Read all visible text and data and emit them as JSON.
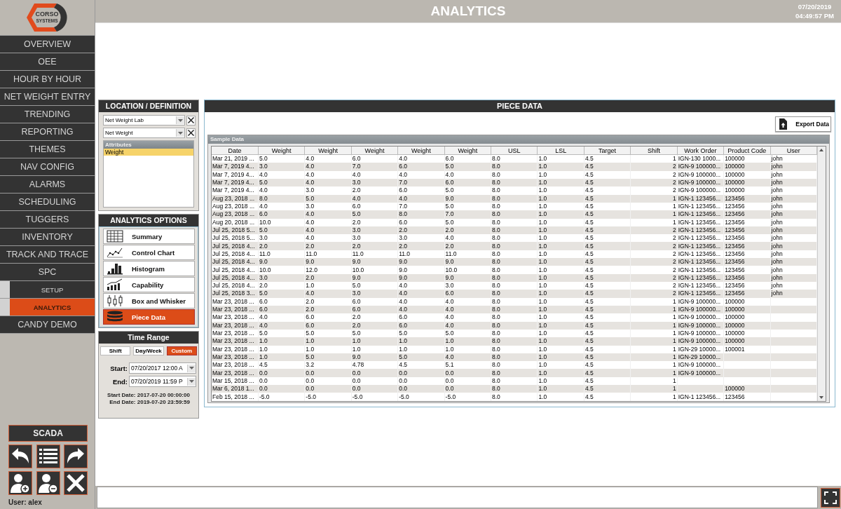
{
  "logo": {
    "line1": "CORSO",
    "line2": "SYSTEMS"
  },
  "header": {
    "title": "ANALYTICS",
    "date": "07/20/2019",
    "time": "04:49:57 PM"
  },
  "nav": [
    {
      "label": "OVERVIEW",
      "kind": "main",
      "selected": false
    },
    {
      "label": "OEE",
      "kind": "main",
      "selected": false
    },
    {
      "label": "HOUR BY HOUR",
      "kind": "main",
      "selected": false
    },
    {
      "label": "NET WEIGHT ENTRY",
      "kind": "main",
      "selected": false
    },
    {
      "label": "TRENDING",
      "kind": "main",
      "selected": false
    },
    {
      "label": "REPORTING",
      "kind": "main",
      "selected": false
    },
    {
      "label": "THEMES",
      "kind": "main",
      "selected": false
    },
    {
      "label": "NAV CONFIG",
      "kind": "main",
      "selected": false
    },
    {
      "label": "ALARMS",
      "kind": "main",
      "selected": false
    },
    {
      "label": "SCHEDULING",
      "kind": "main",
      "selected": false
    },
    {
      "label": "TUGGERS",
      "kind": "main",
      "selected": false
    },
    {
      "label": "INVENTORY",
      "kind": "main",
      "selected": false
    },
    {
      "label": "TRACK AND TRACE",
      "kind": "main",
      "selected": false
    },
    {
      "label": "SPC",
      "kind": "main",
      "selected": false
    },
    {
      "label": "SETUP",
      "kind": "sub",
      "selected": false
    },
    {
      "label": "ANALYTICS",
      "kind": "sub",
      "selected": true
    },
    {
      "label": "CANDY DEMO",
      "kind": "main",
      "selected": false
    }
  ],
  "scada_button": "SCADA",
  "user": "User: alex",
  "location": {
    "title": "LOCATION / DEFINITION",
    "dropdowns": [
      {
        "value": "Net Weight Lab"
      },
      {
        "value": "Net Weight"
      }
    ],
    "attributes": {
      "title": "Attributes",
      "items": [
        {
          "label": "Weight",
          "selected": true
        }
      ]
    }
  },
  "analytics_options": {
    "title": "ANALYTICS OPTIONS",
    "items": [
      {
        "label": "Summary",
        "kind": "summary",
        "selected": false
      },
      {
        "label": "Control Chart",
        "kind": "control",
        "selected": false
      },
      {
        "label": "Histogram",
        "kind": "histogram",
        "selected": false
      },
      {
        "label": "Capability",
        "kind": "capability",
        "selected": false
      },
      {
        "label": "Box and Whisker",
        "kind": "box",
        "selected": false
      },
      {
        "label": "Piece Data",
        "kind": "piece",
        "selected": true
      }
    ]
  },
  "time_range": {
    "title": "Time Range",
    "modes": [
      {
        "label": "Shift",
        "selected": false
      },
      {
        "label": "Day/Week",
        "selected": false
      },
      {
        "label": "Custom",
        "selected": true
      }
    ],
    "start": {
      "label": "Start:",
      "value": "07/20/2017 12:00 A"
    },
    "end": {
      "label": "End:",
      "value": "07/20/2019 11:59 P"
    },
    "start_date": "Start Date: 2017-07-20 00:00:00",
    "end_date": "End Date: 2019-07-20 23:59:59"
  },
  "piece_data": {
    "title": "PIECE DATA",
    "export_button": "Export Data",
    "table": {
      "title": "Sample Data",
      "columns": [
        "Date",
        "Weight",
        "Weight",
        "Weight",
        "Weight",
        "Weight",
        "USL",
        "LSL",
        "Target",
        "Shift",
        "Work Order",
        "Product Code",
        "User"
      ],
      "rows": [
        [
          "Mar 21, 2019 ...",
          "5.0",
          "4.0",
          "6.0",
          "4.0",
          "6.0",
          "8.0",
          "1.0",
          "4.5",
          "1",
          "IGN-130 1000...",
          "100000",
          "john"
        ],
        [
          "Mar 7, 2019 4...",
          "3.0",
          "4.0",
          "7.0",
          "6.0",
          "5.0",
          "8.0",
          "1.0",
          "4.5",
          "2",
          "IGN-9 100000...",
          "100000",
          "john"
        ],
        [
          "Mar 7, 2019 4...",
          "4.0",
          "4.0",
          "4.0",
          "4.0",
          "4.0",
          "8.0",
          "1.0",
          "4.5",
          "2",
          "IGN-9 100000...",
          "100000",
          "john"
        ],
        [
          "Mar 7, 2019 4...",
          "5.0",
          "4.0",
          "3.0",
          "7.0",
          "6.0",
          "8.0",
          "1.0",
          "4.5",
          "2",
          "IGN-9 100000...",
          "100000",
          "john"
        ],
        [
          "Mar 7, 2019 4...",
          "4.0",
          "3.0",
          "2.0",
          "6.0",
          "5.0",
          "8.0",
          "1.0",
          "4.5",
          "2",
          "IGN-9 100000...",
          "100000",
          "john"
        ],
        [
          "Aug 23, 2018 ...",
          "8.0",
          "5.0",
          "4.0",
          "4.0",
          "9.0",
          "8.0",
          "1.0",
          "4.5",
          "1",
          "IGN-1 123456...",
          "123456",
          "john"
        ],
        [
          "Aug 23, 2018 ...",
          "4.0",
          "3.0",
          "6.0",
          "7.0",
          "5.0",
          "8.0",
          "1.0",
          "4.5",
          "1",
          "IGN-1 123456...",
          "123456",
          "john"
        ],
        [
          "Aug 23, 2018 ...",
          "6.0",
          "4.0",
          "5.0",
          "8.0",
          "7.0",
          "8.0",
          "1.0",
          "4.5",
          "1",
          "IGN-1 123456...",
          "123456",
          "john"
        ],
        [
          "Aug 20, 2018 ...",
          "10.0",
          "4.0",
          "2.0",
          "6.0",
          "5.0",
          "8.0",
          "1.0",
          "4.5",
          "1",
          "IGN-1 123456...",
          "123456",
          "john"
        ],
        [
          "Jul 25, 2018 5...",
          "5.0",
          "4.0",
          "3.0",
          "2.0",
          "2.0",
          "8.0",
          "1.0",
          "4.5",
          "2",
          "IGN-1 123456...",
          "123456",
          "john"
        ],
        [
          "Jul 25, 2018 5...",
          "3.0",
          "4.0",
          "3.0",
          "3.0",
          "4.0",
          "8.0",
          "1.0",
          "4.5",
          "2",
          "IGN-1 123456...",
          "123456",
          "john"
        ],
        [
          "Jul 25, 2018 4...",
          "2.0",
          "2.0",
          "2.0",
          "2.0",
          "2.0",
          "8.0",
          "1.0",
          "4.5",
          "2",
          "IGN-1 123456...",
          "123456",
          "john"
        ],
        [
          "Jul 25, 2018 4...",
          "11.0",
          "11.0",
          "11.0",
          "11.0",
          "11.0",
          "8.0",
          "1.0",
          "4.5",
          "2",
          "IGN-1 123456...",
          "123456",
          "john"
        ],
        [
          "Jul 25, 2018 4...",
          "9.0",
          "9.0",
          "9.0",
          "9.0",
          "9.0",
          "8.0",
          "1.0",
          "4.5",
          "2",
          "IGN-1 123456...",
          "123456",
          "john"
        ],
        [
          "Jul 25, 2018 4...",
          "10.0",
          "12.0",
          "10.0",
          "9.0",
          "10.0",
          "8.0",
          "1.0",
          "4.5",
          "2",
          "IGN-1 123456...",
          "123456",
          "john"
        ],
        [
          "Jul 25, 2018 4...",
          "3.0",
          "2.0",
          "9.0",
          "9.0",
          "9.0",
          "8.0",
          "1.0",
          "4.5",
          "2",
          "IGN-1 123456...",
          "123456",
          "john"
        ],
        [
          "Jul 25, 2018 4...",
          "2.0",
          "1.0",
          "5.0",
          "4.0",
          "3.0",
          "8.0",
          "1.0",
          "4.5",
          "2",
          "IGN-1 123456...",
          "123456",
          "john"
        ],
        [
          "Jul 25, 2018 3...",
          "5.0",
          "4.0",
          "3.0",
          "4.0",
          "6.0",
          "8.0",
          "1.0",
          "4.5",
          "2",
          "IGN-1 123456...",
          "123456",
          "john"
        ],
        [
          "Mar 23, 2018 ...",
          "6.0",
          "2.0",
          "6.0",
          "4.0",
          "4.0",
          "8.0",
          "1.0",
          "4.5",
          "1",
          "IGN-9 100000...",
          "100000",
          null
        ],
        [
          "Mar 23, 2018 ...",
          "6.0",
          "2.0",
          "6.0",
          "4.0",
          "4.0",
          "8.0",
          "1.0",
          "4.5",
          "1",
          "IGN-9 100000...",
          "100000",
          null
        ],
        [
          "Mar 23, 2018 ...",
          "4.0",
          "6.0",
          "2.0",
          "6.0",
          "4.0",
          "8.0",
          "1.0",
          "4.5",
          "1",
          "IGN-9 100000...",
          "100000",
          null
        ],
        [
          "Mar 23, 2018 ...",
          "4.0",
          "6.0",
          "2.0",
          "6.0",
          "4.0",
          "8.0",
          "1.0",
          "4.5",
          "1",
          "IGN-9 100000...",
          "100000",
          null
        ],
        [
          "Mar 23, 2018 ...",
          "5.0",
          "5.0",
          "5.0",
          "5.0",
          "5.0",
          "8.0",
          "1.0",
          "4.5",
          "1",
          "IGN-9 100000...",
          "100000",
          null
        ],
        [
          "Mar 23, 2018 ...",
          "1.0",
          "1.0",
          "1.0",
          "1.0",
          "1.0",
          "8.0",
          "1.0",
          "4.5",
          "1",
          "IGN-9 100000...",
          "100000",
          null
        ],
        [
          "Mar 23, 2018 ...",
          "1.0",
          "1.0",
          "1.0",
          "1.0",
          "1.0",
          "8.0",
          "1.0",
          "4.5",
          "1",
          "IGN-29 10000...",
          "100001",
          null
        ],
        [
          "Mar 23, 2018 ...",
          "1.0",
          "5.0",
          "9.0",
          "5.0",
          "4.0",
          "8.0",
          "1.0",
          "4.5",
          "1",
          "IGN-29 10000...",
          null,
          null
        ],
        [
          "Mar 23, 2018 ...",
          "4.5",
          "3.2",
          "4.78",
          "4.5",
          "5.1",
          "8.0",
          "1.0",
          "4.5",
          "1",
          "IGN-9 100000...",
          null,
          null
        ],
        [
          "Mar 23, 2018 ...",
          "0.0",
          "0.0",
          "0.0",
          "0.0",
          "0.0",
          "8.0",
          "1.0",
          "4.5",
          "1",
          "IGN-9 100000...",
          null,
          null
        ],
        [
          "Mar 15, 2018 ...",
          "0.0",
          "0.0",
          "0.0",
          "0.0",
          "0.0",
          "8.0",
          "1.0",
          "4.5",
          "1",
          null,
          null,
          null
        ],
        [
          "Mar 6, 2018 1...",
          "0.0",
          "0.0",
          "0.0",
          "0.0",
          "0.0",
          "8.0",
          "1.0",
          "4.5",
          "1",
          null,
          "100000",
          null
        ],
        [
          "Feb 15, 2018 ...",
          "-5.0",
          "-5.0",
          "-5.0",
          "-5.0",
          "-5.0",
          "8.0",
          "1.0",
          "4.5",
          "1",
          "IGN-1 123456...",
          "123456",
          null
        ]
      ]
    }
  }
}
